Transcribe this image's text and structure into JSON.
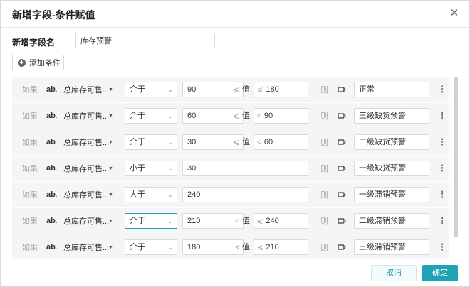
{
  "dialog": {
    "title": "新增字段-条件赋值",
    "close_glyph": "✕"
  },
  "field_name": {
    "label": "新增字段名",
    "value": "库存预警"
  },
  "add_condition": {
    "label": "添加条件",
    "icon_glyph": "+"
  },
  "rows": [
    {
      "if": "如果",
      "type": "ab",
      "field": "总库存可售...",
      "op": "介于",
      "v1": "90",
      "sym1": "⩽",
      "val_word": "值",
      "sym2": "⩽",
      "v2": "180",
      "then": "则",
      "result": "正常",
      "two": true,
      "active": false
    },
    {
      "if": "如果",
      "type": "ab",
      "field": "总库存可售...",
      "op": "介于",
      "v1": "60",
      "sym1": "⩽",
      "val_word": "值",
      "sym2": "<",
      "v2": "90",
      "then": "则",
      "result": "三级缺货预警",
      "two": true,
      "active": false
    },
    {
      "if": "如果",
      "type": "ab",
      "field": "总库存可售...",
      "op": "介于",
      "v1": "30",
      "sym1": "⩽",
      "val_word": "值",
      "sym2": "<",
      "v2": "60",
      "then": "则",
      "result": "二级缺货预警",
      "two": true,
      "active": false
    },
    {
      "if": "如果",
      "type": "ab",
      "field": "总库存可售...",
      "op": "小于",
      "v1": "30",
      "then": "则",
      "result": "一级缺货预警",
      "two": false,
      "active": false
    },
    {
      "if": "如果",
      "type": "ab",
      "field": "总库存可售...",
      "op": "大于",
      "v1": "240",
      "then": "则",
      "result": "一级滞销预警",
      "two": false,
      "active": false
    },
    {
      "if": "如果",
      "type": "ab",
      "field": "总库存可售...",
      "op": "介于",
      "v1": "210",
      "sym1": "<",
      "val_word": "值",
      "sym2": "⩽",
      "v2": "240",
      "then": "则",
      "result": "二级滞销预警",
      "two": true,
      "active": true
    },
    {
      "if": "如果",
      "type": "ab",
      "field": "总库存可售...",
      "op": "介于",
      "v1": "180",
      "sym1": "<",
      "val_word": "值",
      "sym2": "⩽",
      "v2": "210",
      "then": "则",
      "result": "三级滞销预警",
      "two": true,
      "active": false
    }
  ],
  "icons": {
    "field_type": "ab-text-icon",
    "caret": "caret-down-icon",
    "tag": "tag-icon",
    "more": "more-vertical-icon"
  },
  "footer": {
    "cancel": "取消",
    "ok": "确定"
  },
  "colors": {
    "accent": "#1fa2b6",
    "row_bg": "#f5f5f5"
  }
}
